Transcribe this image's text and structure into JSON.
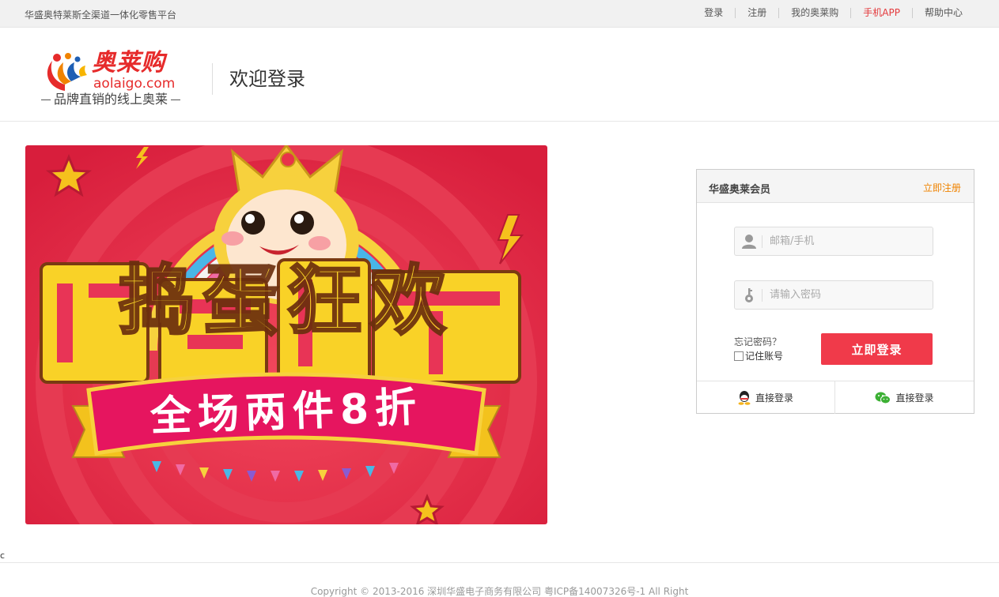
{
  "topbar": {
    "slogan": "华盛奥特莱斯全渠道一体化零售平台",
    "nav": [
      "登录",
      "注册",
      "我的奥莱购",
      "手机APP",
      "帮助中心"
    ]
  },
  "logo": {
    "cn": "奥莱购",
    "en": "aolaigo.com",
    "tagline": "品牌直销的线上奥莱"
  },
  "header": {
    "welcome": "欢迎登录"
  },
  "banner": {
    "headline": "捣蛋狂欢",
    "ribbon": "全场两件8折"
  },
  "login": {
    "title": "华盛奥莱会员",
    "register_link": "立即注册",
    "username_placeholder": "邮箱/手机",
    "password_placeholder": "请输入密码",
    "forgot": "忘记密码？",
    "remember": "记住账号",
    "submit": "立即登录",
    "qq_login": "直接登录",
    "wechat_login": "直接登录"
  },
  "stray_char": "c",
  "footer": {
    "copyright": "Copyright © 2013-2016 深圳华盛电子商务有限公司 粤ICP备14007326号-1 All Right"
  },
  "colors": {
    "accent": "#f03a4a",
    "register": "#f08300",
    "brand": "#e62b2b"
  },
  "icons": [
    "user-icon",
    "key-icon",
    "qq-icon",
    "wechat-icon"
  ]
}
